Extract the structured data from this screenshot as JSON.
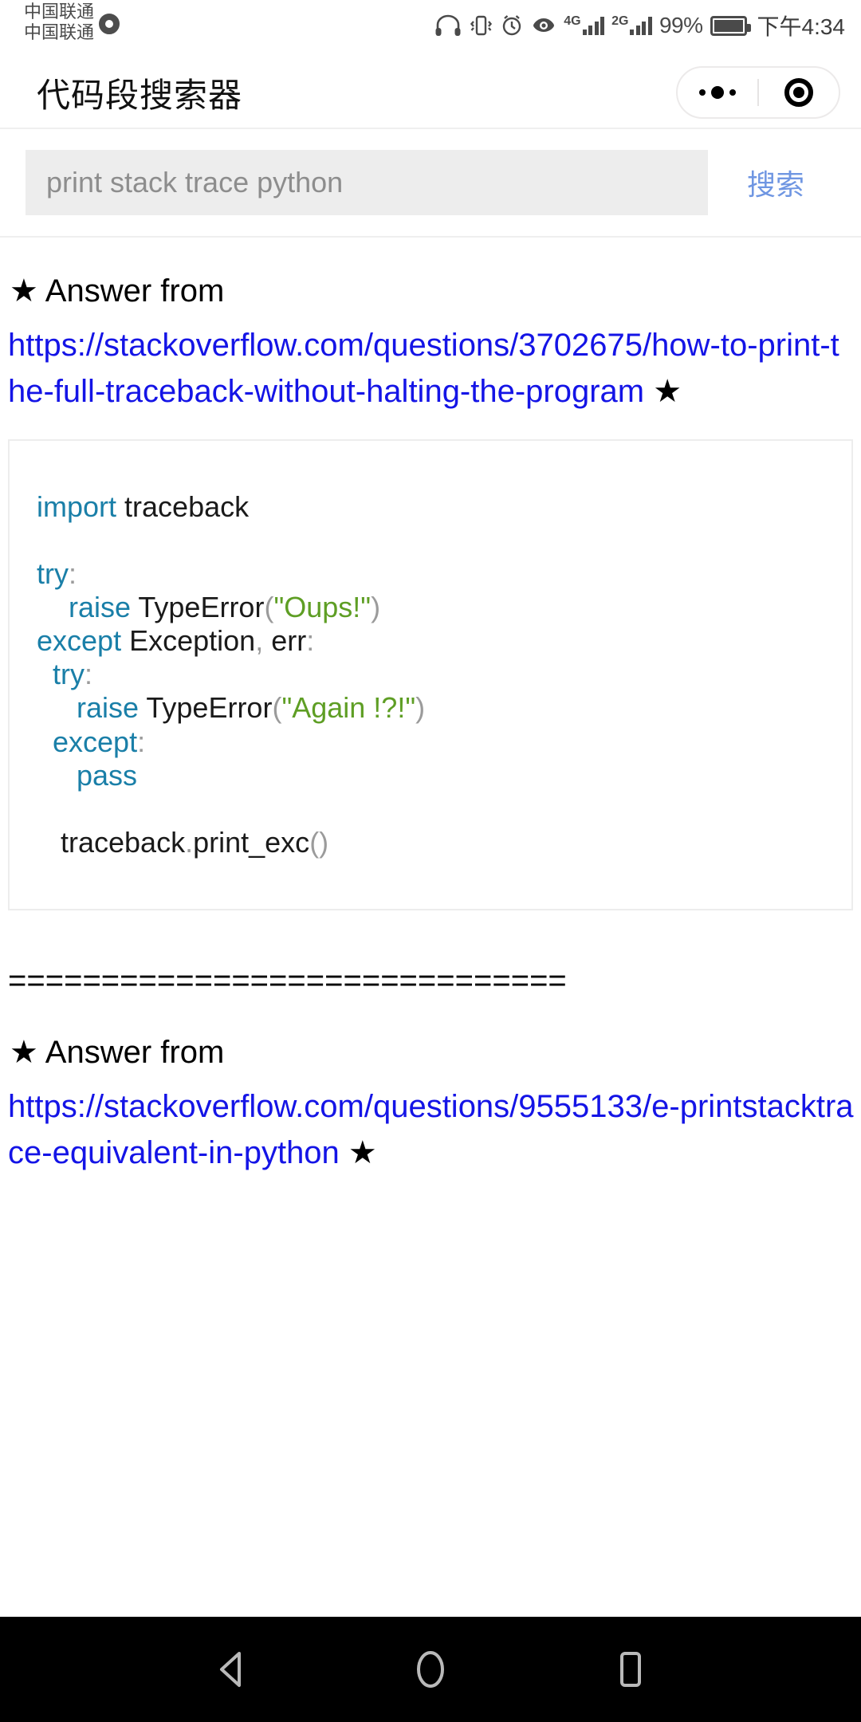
{
  "status_bar": {
    "carrier_line_1": "中国联通",
    "carrier_line_2": "中国联通",
    "icons": [
      "headphone-icon",
      "vibrate-icon",
      "alarm-icon",
      "eye-icon"
    ],
    "network_1": "4G",
    "network_2": "2G",
    "battery_percent": "99%",
    "clock": "下午4:34"
  },
  "title_bar": {
    "app_title": "代码段搜索器",
    "menu_icon": "more-dots-icon",
    "close_icon": "target-circle-icon"
  },
  "search": {
    "placeholder": "print stack trace python",
    "value": "",
    "button_label": "搜索"
  },
  "results": [
    {
      "heading": "★ Answer from",
      "url": "https://stackoverflow.com/questions/3702675/how-to-print-the-full-traceback-without-halting-the-program",
      "url_suffix_star": " ★",
      "code_lines": [
        [
          {
            "t": "import",
            "c": "kw"
          },
          {
            "t": " traceback",
            "c": ""
          }
        ],
        [],
        [
          {
            "t": "try",
            "c": "kw"
          },
          {
            "t": ":",
            "c": "punc"
          }
        ],
        [
          {
            "t": "    ",
            "c": ""
          },
          {
            "t": "raise",
            "c": "kw"
          },
          {
            "t": " TypeError",
            "c": ""
          },
          {
            "t": "(",
            "c": "punc"
          },
          {
            "t": "\"Oups!\"",
            "c": "str"
          },
          {
            "t": ")",
            "c": "punc"
          }
        ],
        [
          {
            "t": "except",
            "c": "kw"
          },
          {
            "t": " Exception",
            "c": ""
          },
          {
            "t": ",",
            "c": "punc"
          },
          {
            "t": " err",
            "c": ""
          },
          {
            "t": ":",
            "c": "punc"
          }
        ],
        [
          {
            "t": "  ",
            "c": ""
          },
          {
            "t": "try",
            "c": "kw"
          },
          {
            "t": ":",
            "c": "punc"
          }
        ],
        [
          {
            "t": "     ",
            "c": ""
          },
          {
            "t": "raise",
            "c": "kw"
          },
          {
            "t": " TypeError",
            "c": ""
          },
          {
            "t": "(",
            "c": "punc"
          },
          {
            "t": "\"Again !?!\"",
            "c": "str"
          },
          {
            "t": ")",
            "c": "punc"
          }
        ],
        [
          {
            "t": "  ",
            "c": ""
          },
          {
            "t": "except",
            "c": "kw"
          },
          {
            "t": ":",
            "c": "punc"
          }
        ],
        [
          {
            "t": "     ",
            "c": ""
          },
          {
            "t": "pass",
            "c": "kw"
          }
        ],
        [],
        [
          {
            "t": "   traceback",
            "c": ""
          },
          {
            "t": ".",
            "c": "punc"
          },
          {
            "t": "print_exc",
            "c": ""
          },
          {
            "t": "()",
            "c": "punc"
          }
        ]
      ]
    },
    {
      "heading": "★ Answer from",
      "url": "https://stackoverflow.com/questions/9555133/e-printstacktrace-equivalent-in-python",
      "url_suffix_star": " ★",
      "code_lines": []
    }
  ],
  "divider": "==============================",
  "nav_bar": {
    "back_icon": "back-triangle-icon",
    "home_icon": "home-circle-icon",
    "recents_icon": "recents-square-icon"
  },
  "colors": {
    "link": "#1414e6",
    "search_button": "#6f96e2",
    "keyword": "#1a7fa8",
    "string": "#5e9e24",
    "punctuation": "#9b9b9b"
  }
}
